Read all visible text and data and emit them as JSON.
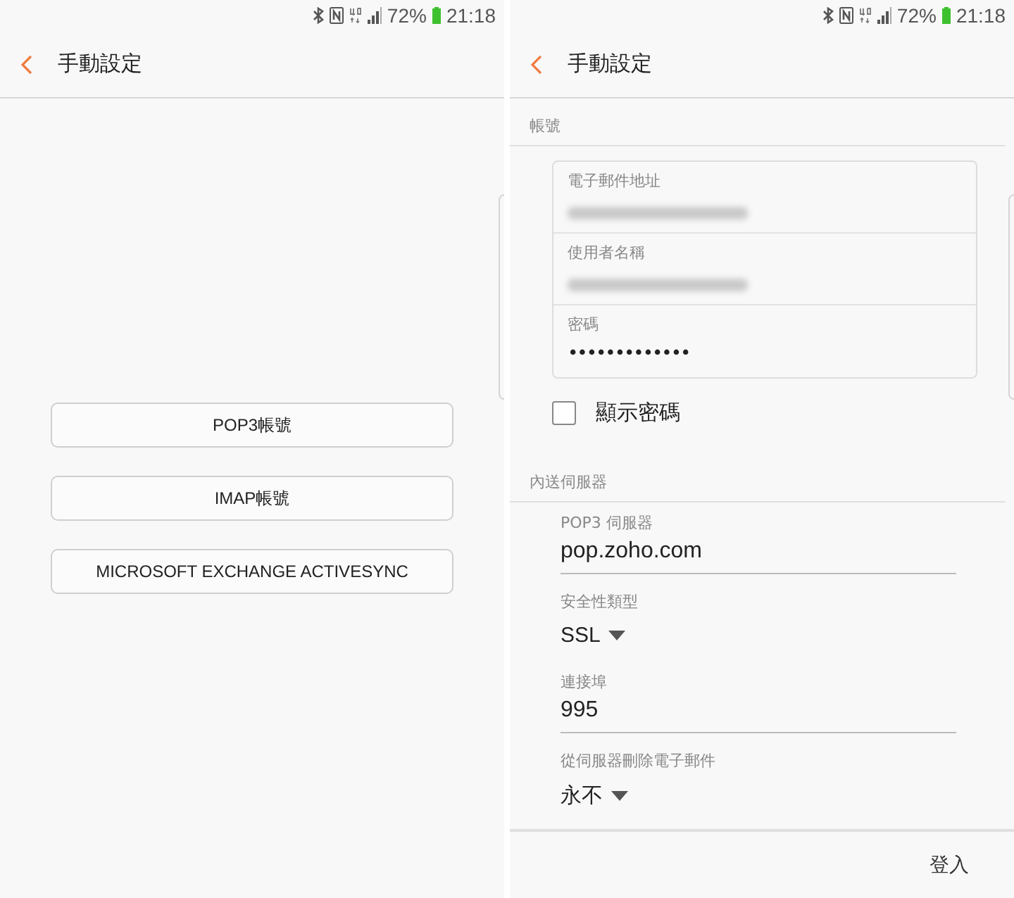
{
  "screens": [
    {
      "status_bar": {
        "battery": "72%",
        "time": "21:18"
      },
      "header": {
        "title": "手動設定"
      },
      "buttons": [
        "POP3帳號",
        "IMAP帳號",
        "MICROSOFT EXCHANGE ACTIVESYNC"
      ]
    },
    {
      "status_bar": {
        "battery": "72%",
        "time": "21:18"
      },
      "header": {
        "title": "手動設定"
      },
      "sections": [
        {
          "title": "帳號",
          "kind": "card",
          "fields": [
            {
              "label": "電子郵件地址",
              "redacted": true
            },
            {
              "label": "使用者名稱",
              "redacted": true
            },
            {
              "label": "密碼",
              "value": "•••••••••••••"
            }
          ],
          "checkbox": {
            "label": "顯示密碼",
            "checked": false
          }
        },
        {
          "title": "內送伺服器",
          "kind": "form",
          "fields": [
            {
              "kind": "text",
              "label": "POP3 伺服器",
              "value": "pop.zoho.com"
            },
            {
              "kind": "select",
              "label": "安全性類型",
              "value": "SSL"
            },
            {
              "kind": "text",
              "label": "連接埠",
              "value": "995"
            },
            {
              "kind": "select",
              "label": "從伺服器刪除電子郵件",
              "value": "永不"
            }
          ]
        }
      ],
      "footer_button": "登入"
    }
  ]
}
